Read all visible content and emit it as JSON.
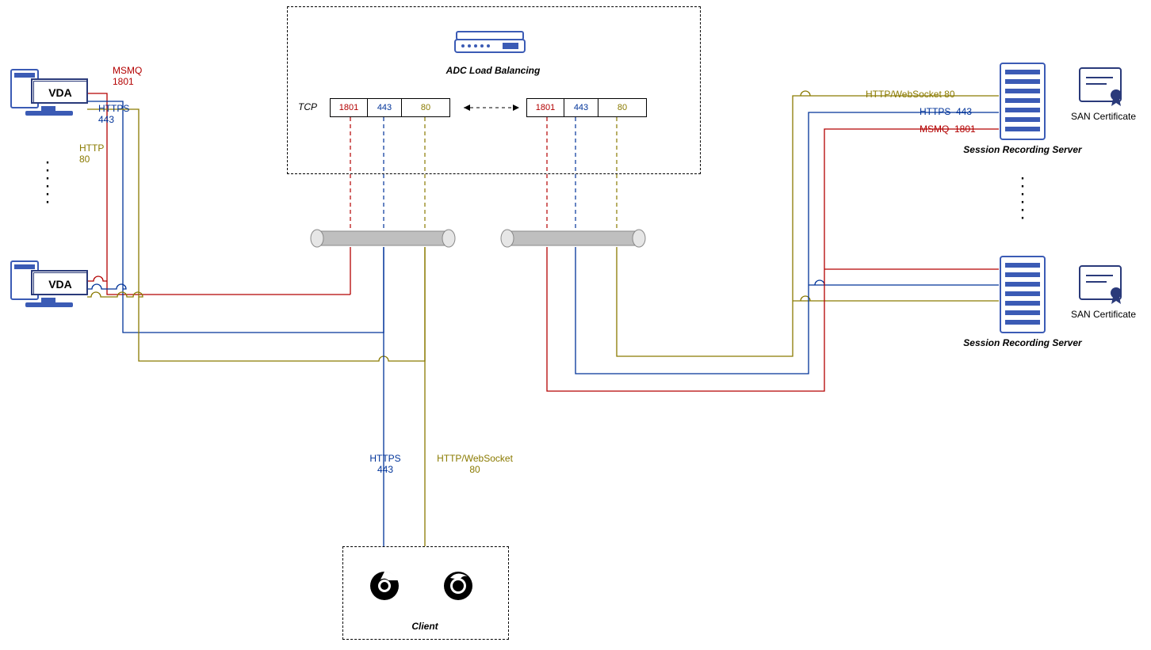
{
  "adc": {
    "title": "ADC Load Balancing",
    "tcp_label": "TCP",
    "ports_left": {
      "p1801": "1801",
      "p443": "443",
      "p80": "80"
    },
    "ports_right": {
      "p1801": "1801",
      "p443": "443",
      "p80": "80"
    }
  },
  "vda": {
    "label_top": "VDA",
    "label_bottom": "VDA",
    "msmq_label": "MSMQ\n1801",
    "https_label": "HTTPS\n443",
    "http_label": "HTTP\n80"
  },
  "servers": {
    "httpws_label": "HTTP/WebSocket 80",
    "https_label": "HTTPS  443",
    "msmq_label": "MSMQ  1801",
    "server_caption": "Session Recording Server",
    "san_caption": "SAN Certificate"
  },
  "client": {
    "https_label": "HTTPS\n443",
    "httpws_label": "HTTP/WebSocket\n80",
    "caption": "Client"
  }
}
